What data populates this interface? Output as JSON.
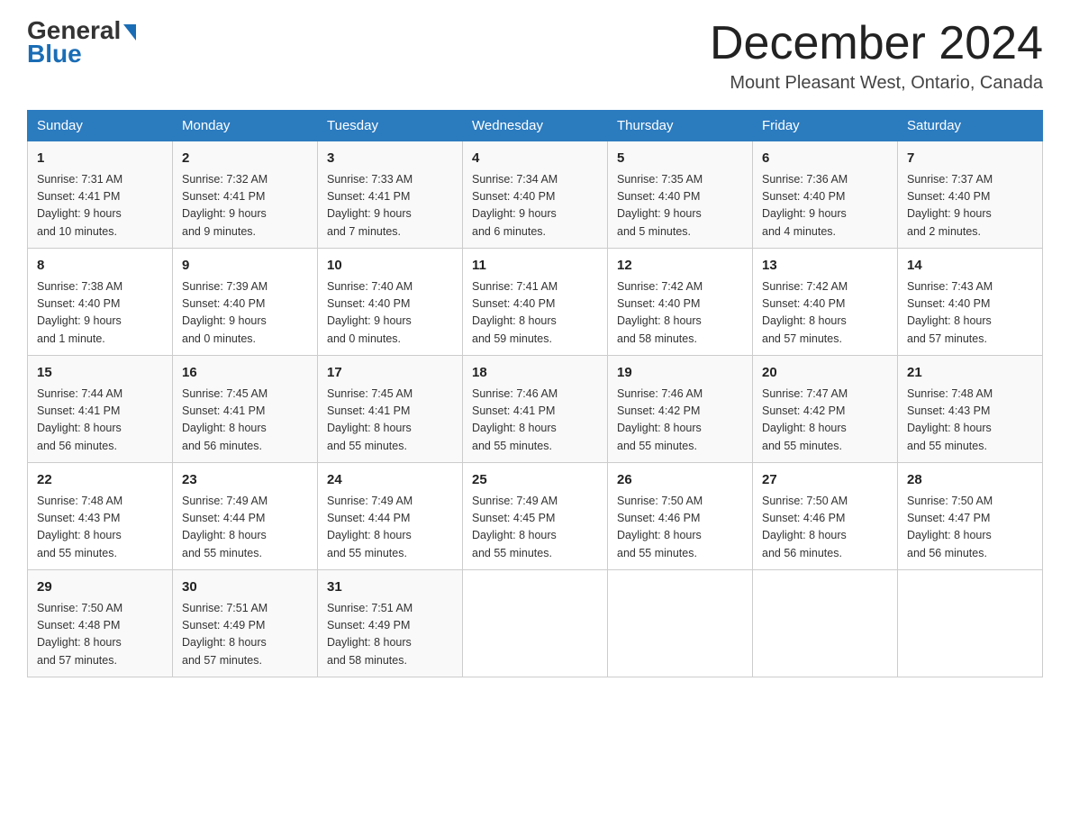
{
  "header": {
    "logo": {
      "general": "General",
      "blue": "Blue"
    },
    "month_title": "December 2024",
    "location": "Mount Pleasant West, Ontario, Canada"
  },
  "weekdays": [
    "Sunday",
    "Monday",
    "Tuesday",
    "Wednesday",
    "Thursday",
    "Friday",
    "Saturday"
  ],
  "weeks": [
    [
      {
        "day": "1",
        "sunrise": "7:31 AM",
        "sunset": "4:41 PM",
        "daylight": "9 hours and 10 minutes."
      },
      {
        "day": "2",
        "sunrise": "7:32 AM",
        "sunset": "4:41 PM",
        "daylight": "9 hours and 9 minutes."
      },
      {
        "day": "3",
        "sunrise": "7:33 AM",
        "sunset": "4:41 PM",
        "daylight": "9 hours and 7 minutes."
      },
      {
        "day": "4",
        "sunrise": "7:34 AM",
        "sunset": "4:40 PM",
        "daylight": "9 hours and 6 minutes."
      },
      {
        "day": "5",
        "sunrise": "7:35 AM",
        "sunset": "4:40 PM",
        "daylight": "9 hours and 5 minutes."
      },
      {
        "day": "6",
        "sunrise": "7:36 AM",
        "sunset": "4:40 PM",
        "daylight": "9 hours and 4 minutes."
      },
      {
        "day": "7",
        "sunrise": "7:37 AM",
        "sunset": "4:40 PM",
        "daylight": "9 hours and 2 minutes."
      }
    ],
    [
      {
        "day": "8",
        "sunrise": "7:38 AM",
        "sunset": "4:40 PM",
        "daylight": "9 hours and 1 minute."
      },
      {
        "day": "9",
        "sunrise": "7:39 AM",
        "sunset": "4:40 PM",
        "daylight": "9 hours and 0 minutes."
      },
      {
        "day": "10",
        "sunrise": "7:40 AM",
        "sunset": "4:40 PM",
        "daylight": "9 hours and 0 minutes."
      },
      {
        "day": "11",
        "sunrise": "7:41 AM",
        "sunset": "4:40 PM",
        "daylight": "8 hours and 59 minutes."
      },
      {
        "day": "12",
        "sunrise": "7:42 AM",
        "sunset": "4:40 PM",
        "daylight": "8 hours and 58 minutes."
      },
      {
        "day": "13",
        "sunrise": "7:42 AM",
        "sunset": "4:40 PM",
        "daylight": "8 hours and 57 minutes."
      },
      {
        "day": "14",
        "sunrise": "7:43 AM",
        "sunset": "4:40 PM",
        "daylight": "8 hours and 57 minutes."
      }
    ],
    [
      {
        "day": "15",
        "sunrise": "7:44 AM",
        "sunset": "4:41 PM",
        "daylight": "8 hours and 56 minutes."
      },
      {
        "day": "16",
        "sunrise": "7:45 AM",
        "sunset": "4:41 PM",
        "daylight": "8 hours and 56 minutes."
      },
      {
        "day": "17",
        "sunrise": "7:45 AM",
        "sunset": "4:41 PM",
        "daylight": "8 hours and 55 minutes."
      },
      {
        "day": "18",
        "sunrise": "7:46 AM",
        "sunset": "4:41 PM",
        "daylight": "8 hours and 55 minutes."
      },
      {
        "day": "19",
        "sunrise": "7:46 AM",
        "sunset": "4:42 PM",
        "daylight": "8 hours and 55 minutes."
      },
      {
        "day": "20",
        "sunrise": "7:47 AM",
        "sunset": "4:42 PM",
        "daylight": "8 hours and 55 minutes."
      },
      {
        "day": "21",
        "sunrise": "7:48 AM",
        "sunset": "4:43 PM",
        "daylight": "8 hours and 55 minutes."
      }
    ],
    [
      {
        "day": "22",
        "sunrise": "7:48 AM",
        "sunset": "4:43 PM",
        "daylight": "8 hours and 55 minutes."
      },
      {
        "day": "23",
        "sunrise": "7:49 AM",
        "sunset": "4:44 PM",
        "daylight": "8 hours and 55 minutes."
      },
      {
        "day": "24",
        "sunrise": "7:49 AM",
        "sunset": "4:44 PM",
        "daylight": "8 hours and 55 minutes."
      },
      {
        "day": "25",
        "sunrise": "7:49 AM",
        "sunset": "4:45 PM",
        "daylight": "8 hours and 55 minutes."
      },
      {
        "day": "26",
        "sunrise": "7:50 AM",
        "sunset": "4:46 PM",
        "daylight": "8 hours and 55 minutes."
      },
      {
        "day": "27",
        "sunrise": "7:50 AM",
        "sunset": "4:46 PM",
        "daylight": "8 hours and 56 minutes."
      },
      {
        "day": "28",
        "sunrise": "7:50 AM",
        "sunset": "4:47 PM",
        "daylight": "8 hours and 56 minutes."
      }
    ],
    [
      {
        "day": "29",
        "sunrise": "7:50 AM",
        "sunset": "4:48 PM",
        "daylight": "8 hours and 57 minutes."
      },
      {
        "day": "30",
        "sunrise": "7:51 AM",
        "sunset": "4:49 PM",
        "daylight": "8 hours and 57 minutes."
      },
      {
        "day": "31",
        "sunrise": "7:51 AM",
        "sunset": "4:49 PM",
        "daylight": "8 hours and 58 minutes."
      },
      null,
      null,
      null,
      null
    ]
  ],
  "labels": {
    "sunrise": "Sunrise:",
    "sunset": "Sunset:",
    "daylight": "Daylight:"
  }
}
